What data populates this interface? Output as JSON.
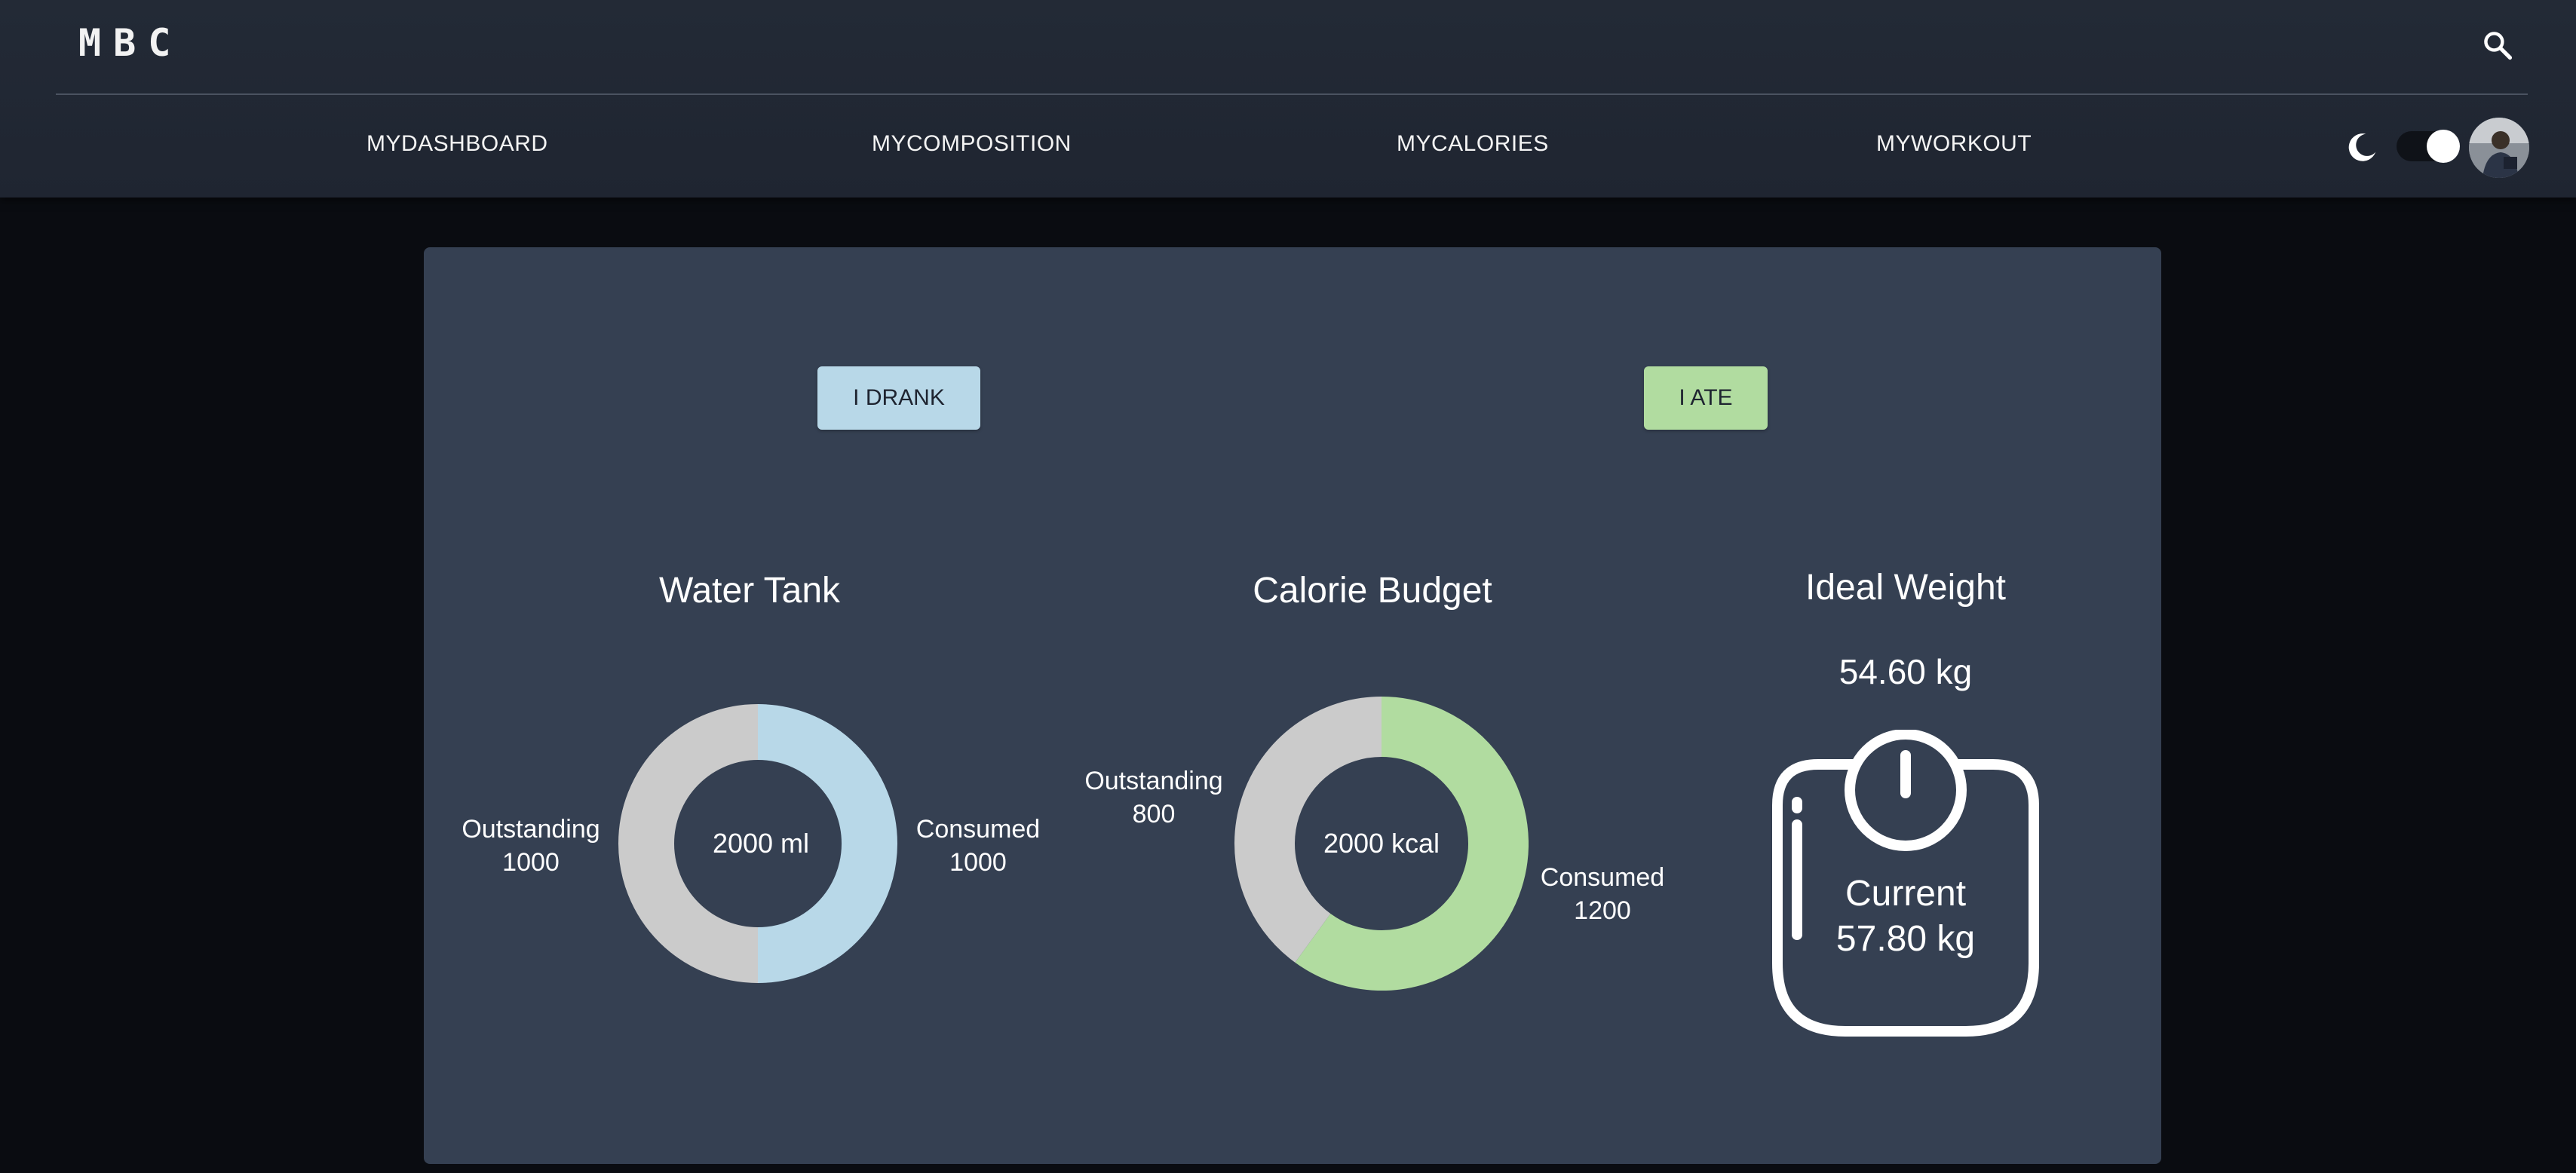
{
  "header": {
    "logo": "MBC",
    "nav": [
      {
        "label": "MYDASHBOARD"
      },
      {
        "label": "MYCOMPOSITION"
      },
      {
        "label": "MYCALORIES"
      },
      {
        "label": "MYWORKOUT"
      }
    ],
    "icons": {
      "search": "search-icon",
      "theme": "moon-icon"
    },
    "dark_mode_on": true
  },
  "actions": {
    "drank_label": "I DRANK",
    "ate_label": "I ATE"
  },
  "water": {
    "title": "Water Tank",
    "center": "2000 ml",
    "outstanding_label": "Outstanding",
    "outstanding_value": "1000",
    "consumed_label": "Consumed",
    "consumed_value": "1000"
  },
  "calories": {
    "title": "Calorie Budget",
    "center": "2000 kcal",
    "outstanding_label": "Outstanding",
    "outstanding_value": "800",
    "consumed_label": "Consumed",
    "consumed_value": "1200"
  },
  "weight": {
    "title": "Ideal Weight",
    "ideal": "54.60 kg",
    "current_label": "Current",
    "current_value": "57.80 kg"
  },
  "colors": {
    "water_consumed": "#b8d8e8",
    "calorie_consumed": "#b1dca0",
    "outstanding": "#cbcbcb"
  },
  "chart_data": [
    {
      "type": "pie",
      "title": "Water Tank",
      "categories": [
        "Outstanding",
        "Consumed"
      ],
      "values": [
        1000,
        1000
      ],
      "colors": [
        "#cbcbcb",
        "#b8d8e8"
      ]
    },
    {
      "type": "pie",
      "title": "Calorie Budget",
      "categories": [
        "Outstanding",
        "Consumed"
      ],
      "values": [
        800,
        1200
      ],
      "colors": [
        "#cbcbcb",
        "#b1dca0"
      ]
    }
  ]
}
